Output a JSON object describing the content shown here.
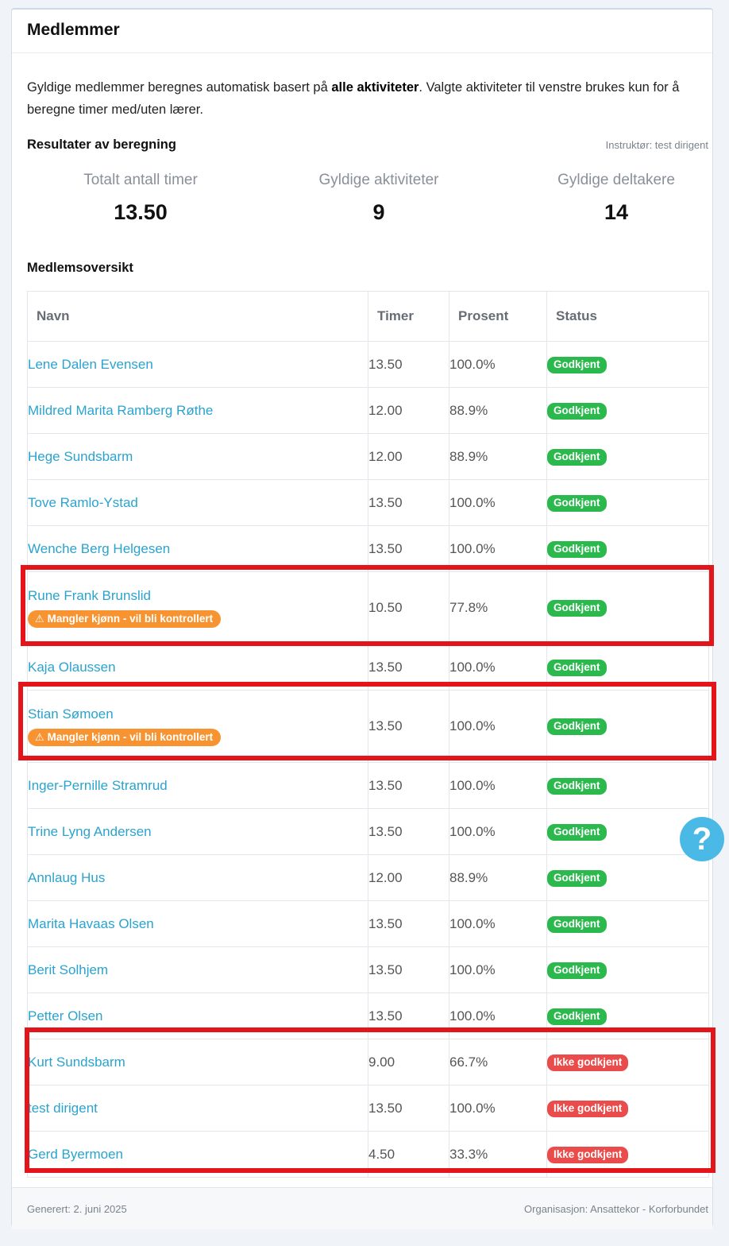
{
  "card": {
    "title": "Medlemmer",
    "intro": {
      "part1": "Gyldige medlemmer beregnes automatisk basert på ",
      "bold": "alle aktiviteter",
      "part2": ". Valgte aktiviteter til venstre brukes kun for å beregne timer med/uten lærer."
    }
  },
  "results": {
    "title": "Resultater av beregning",
    "instructor": "Instruktør: test dirigent",
    "stats": [
      {
        "label": "Totalt antall timer",
        "value": "13.50"
      },
      {
        "label": "Gyldige aktiviteter",
        "value": "9"
      },
      {
        "label": "Gyldige deltakere",
        "value": "14"
      }
    ]
  },
  "overview": {
    "title": "Medlemsoversikt",
    "columns": [
      "Navn",
      "Timer",
      "Prosent",
      "Status"
    ],
    "warning_text": "Mangler kjønn - vil bli kontrollert",
    "rows": [
      {
        "name": "Lene Dalen Evensen",
        "hours": "13.50",
        "percent": "100.0%",
        "status": "Godkjent"
      },
      {
        "name": "Mildred Marita Ramberg Røthe",
        "hours": "12.00",
        "percent": "88.9%",
        "status": "Godkjent"
      },
      {
        "name": "Hege Sundsbarm",
        "hours": "12.00",
        "percent": "88.9%",
        "status": "Godkjent"
      },
      {
        "name": "Tove Ramlo-Ystad",
        "hours": "13.50",
        "percent": "100.0%",
        "status": "Godkjent"
      },
      {
        "name": "Wenche Berg Helgesen",
        "hours": "13.50",
        "percent": "100.0%",
        "status": "Godkjent"
      },
      {
        "name": "Rune Frank Brunslid",
        "hours": "10.50",
        "percent": "77.8%",
        "status": "Godkjent"
      },
      {
        "name": "Kaja Olaussen",
        "hours": "13.50",
        "percent": "100.0%",
        "status": "Godkjent"
      },
      {
        "name": "Stian Sømoen",
        "hours": "13.50",
        "percent": "100.0%",
        "status": "Godkjent"
      },
      {
        "name": "Inger-Pernille Stramrud",
        "hours": "13.50",
        "percent": "100.0%",
        "status": "Godkjent"
      },
      {
        "name": "Trine Lyng Andersen",
        "hours": "13.50",
        "percent": "100.0%",
        "status": "Godkjent"
      },
      {
        "name": "Annlaug Hus",
        "hours": "12.00",
        "percent": "88.9%",
        "status": "Godkjent"
      },
      {
        "name": "Marita Havaas Olsen",
        "hours": "13.50",
        "percent": "100.0%",
        "status": "Godkjent"
      },
      {
        "name": "Berit Solhjem",
        "hours": "13.50",
        "percent": "100.0%",
        "status": "Godkjent"
      },
      {
        "name": "Petter Olsen",
        "hours": "13.50",
        "percent": "100.0%",
        "status": "Godkjent"
      },
      {
        "name": "Kurt Sundsbarm",
        "hours": "9.00",
        "percent": "66.7%",
        "status": "Ikke godkjent"
      },
      {
        "name": "test dirigent",
        "hours": "13.50",
        "percent": "100.0%",
        "status": "Ikke godkjent"
      },
      {
        "name": "Gerd Byermoen",
        "hours": "4.50",
        "percent": "33.3%",
        "status": "Ikke godkjent"
      }
    ]
  },
  "help_button": {
    "label": "?"
  },
  "footer": {
    "generated": "Generert: 2. juni 2025",
    "organisation": "Organisasjon: Ansattekor - Korforbundet"
  },
  "colors": {
    "link": "#2aa3cf",
    "approved": "#2bb84d",
    "not_approved": "#ea4b4b",
    "warning": "#f79431",
    "highlight": "#e3151b",
    "help": "#4ab9e6"
  }
}
